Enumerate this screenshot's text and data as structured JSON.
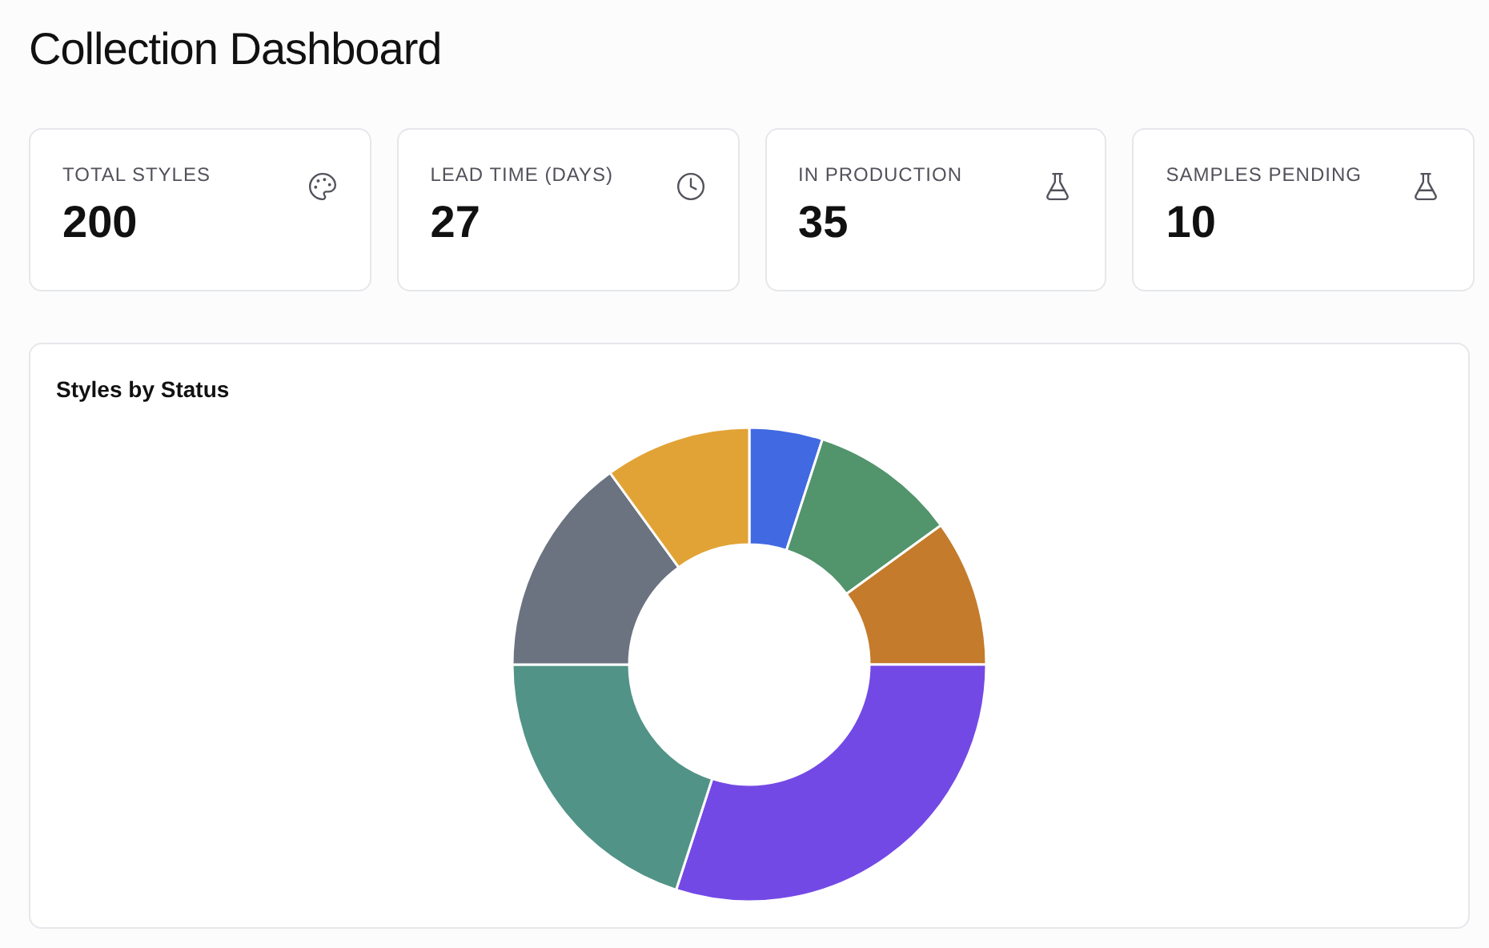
{
  "title": "Collection Dashboard",
  "stats": [
    {
      "label": "TOTAL STYLES",
      "value": "200",
      "kind": "palette"
    },
    {
      "label": "LEAD TIME (DAYS)",
      "value": "27",
      "kind": "clock"
    },
    {
      "label": "IN PRODUCTION",
      "value": "35",
      "kind": "flask"
    },
    {
      "label": "SAMPLES PENDING",
      "value": "10",
      "kind": "flask"
    }
  ],
  "chart": {
    "title": "Styles by Status"
  }
}
